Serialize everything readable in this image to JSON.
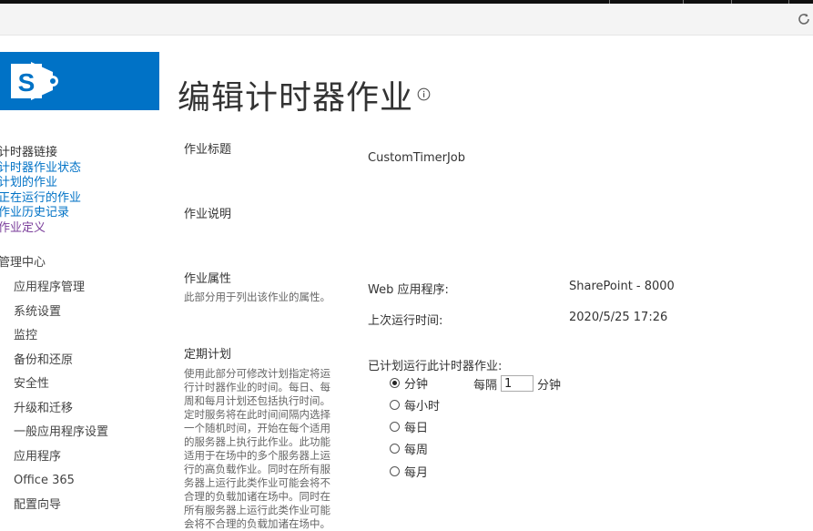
{
  "page": {
    "title": "编辑计时器作业"
  },
  "nav": {
    "timer_links_heading": "计时器链接",
    "timer_links": [
      {
        "label": "计时器作业状态"
      },
      {
        "label": "计划的作业"
      },
      {
        "label": "正在运行的作业"
      },
      {
        "label": "作业历史记录"
      },
      {
        "label": "作业定义"
      }
    ],
    "central_admin_heading": "管理中心",
    "central_admin_items": [
      {
        "label": "应用程序管理"
      },
      {
        "label": "系统设置"
      },
      {
        "label": "监控"
      },
      {
        "label": "备份和还原"
      },
      {
        "label": "安全性"
      },
      {
        "label": "升级和迁移"
      },
      {
        "label": "一般应用程序设置"
      },
      {
        "label": "应用程序"
      },
      {
        "label": "Office 365"
      },
      {
        "label": "配置向导"
      }
    ]
  },
  "form": {
    "job_title": {
      "label": "作业标题",
      "value": "CustomTimerJob"
    },
    "job_description": {
      "label": "作业说明"
    },
    "job_properties": {
      "label": "作业属性",
      "description": "此部分用于列出该作业的属性。",
      "web_app_label": "Web 应用程序:",
      "web_app_value": "SharePoint - 8000",
      "last_run_label": "上次运行时间:",
      "last_run_value": "2020/5/25 17:26"
    },
    "schedule": {
      "label": "定期计划",
      "description": "使用此部分可修改计划指定将运行计时器作业的时间。每日、每周和每月计划还包括执行时间。定时服务将在此时间间隔内选择一个随机时间，开始在每个适用的服务器上执行此作业。此功能适用于在场中的多个服务器上运行的高负载作业。同时在所有服务器上运行此类作业可能会将不合理的负载加诸在场中。同时在所有服务器上运行此类作业可能会将不合理的负载加诸在场中。",
      "prompt": "已计划运行此计时器作业:",
      "options": [
        {
          "label": "分钟",
          "checked": true
        },
        {
          "label": "每小时",
          "checked": false
        },
        {
          "label": "每日",
          "checked": false
        },
        {
          "label": "每周",
          "checked": false
        },
        {
          "label": "每月",
          "checked": false
        }
      ],
      "interval_prefix": "每隔",
      "interval_value": "1",
      "interval_suffix": "分钟"
    }
  },
  "colors": {
    "brand": "#0072c6",
    "link": "#0072c6",
    "visited_link": "#7b3e9b"
  }
}
